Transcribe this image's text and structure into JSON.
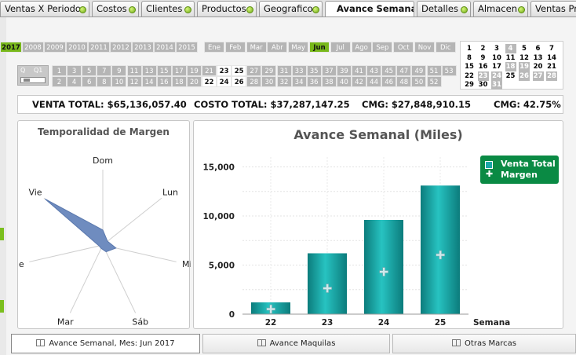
{
  "tabs": [
    {
      "label": "Ventas X Periodo",
      "dot": true
    },
    {
      "label": "Costos",
      "dot": true
    },
    {
      "label": "Clientes",
      "dot": true
    },
    {
      "label": "Productos",
      "dot": true
    },
    {
      "label": "Geografico",
      "dot": true
    },
    {
      "label": "Avance Semanal",
      "dot": false,
      "active": true
    },
    {
      "label": "Detalles",
      "dot": true
    },
    {
      "label": "Almacen",
      "dot": true
    },
    {
      "label": "Ventas Pr",
      "dot": false
    }
  ],
  "years": {
    "items": [
      "2017",
      "2008",
      "2009",
      "2010",
      "2011",
      "2012",
      "2013",
      "2014",
      "2015"
    ],
    "selected": "2017"
  },
  "months": {
    "items": [
      "Ene",
      "Feb",
      "Mar",
      "Abr",
      "May",
      "Jun",
      "Jul",
      "Ago",
      "Sep",
      "Oct",
      "Nov",
      "Dic"
    ],
    "selected": "Jun",
    "white": [
      "Ene"
    ]
  },
  "week_search": {
    "label1": "Q",
    "label2": "Q1"
  },
  "weeks": {
    "row1": [
      "1",
      "3",
      "5",
      "7",
      "9",
      "11",
      "13",
      "15",
      "17",
      "19",
      "21",
      "23",
      "25",
      "27",
      "29",
      "31",
      "33",
      "35",
      "37",
      "39",
      "41",
      "43",
      "45",
      "47",
      "49",
      "51",
      "53"
    ],
    "row2": [
      "2",
      "4",
      "6",
      "8",
      "10",
      "12",
      "14",
      "16",
      "18",
      "20",
      "22",
      "24",
      "26",
      "28",
      "30",
      "32",
      "34",
      "36",
      "38",
      "40",
      "42",
      "44",
      "46",
      "48",
      "50",
      "52"
    ],
    "selected": [
      "22",
      "23",
      "24",
      "25",
      "26"
    ]
  },
  "calendar": {
    "rows": [
      [
        "1",
        "2",
        "3",
        "4",
        "5",
        "6",
        "7"
      ],
      [
        "8",
        "9",
        "10",
        "11",
        "12",
        "13",
        "14"
      ],
      [
        "15",
        "16",
        "17",
        "18",
        "19",
        "20",
        "21"
      ],
      [
        "22",
        "23",
        "24",
        "25",
        "26",
        "27",
        "28"
      ],
      [
        "29",
        "30",
        "31",
        "",
        "",
        "",
        ""
      ]
    ],
    "visible_rows": [
      [
        "",
        "1",
        "2",
        "3",
        "4",
        "5",
        "6",
        "7"
      ],
      [
        "",
        "8",
        "9",
        "10",
        "11",
        "12",
        "13",
        "14"
      ],
      [
        "",
        "15",
        "16",
        "17",
        "18",
        "19",
        "20",
        "21"
      ],
      [
        "",
        "22",
        "23",
        "24",
        "25",
        "26",
        "27",
        "28"
      ],
      [
        "",
        "29",
        "30",
        "31",
        "",
        "",
        "",
        ""
      ]
    ],
    "gray": [
      "4",
      "18",
      "19",
      "23",
      "24",
      "26",
      "27",
      "28",
      "31"
    ]
  },
  "totals": {
    "venta": "VENTA TOTAL: $65,136,057.40",
    "costo": "COSTO TOTAL: $37,287,147.25",
    "cmg": "CMG: $27,848,910.15",
    "cmg_pct": "CMG: 42.75%"
  },
  "radar": {
    "title": "Temporalidad de Margen",
    "axes": [
      "Dom",
      "Lun",
      "Mi",
      "Sáb",
      "Mar",
      "ue",
      "Vie"
    ],
    "values": [
      0.2,
      0.08,
      0.18,
      0.1,
      0.05,
      0.05,
      0.98
    ]
  },
  "chart_data": {
    "type": "bar",
    "title": "Avance Semanal (Miles)",
    "xlabel": "Semana",
    "ylabel": "",
    "categories": [
      "22",
      "23",
      "24",
      "25"
    ],
    "series": [
      {
        "name": "Venta Total",
        "type": "bar",
        "values": [
          1200,
          6200,
          9600,
          13100
        ]
      },
      {
        "name": "Margen",
        "type": "point",
        "values": [
          500,
          2600,
          4300,
          6000
        ]
      }
    ],
    "ylim": [
      0,
      16000
    ],
    "yticks": [
      "0",
      "5,000",
      "10,000",
      "15,000"
    ],
    "colors": {
      "bar": "#1aa7a7",
      "bar_dark": "#0c7c7c",
      "legend_bg": "#0a8a44"
    }
  },
  "bottom_tabs": [
    {
      "label": "Avance Semanal, Mes: Jun 2017",
      "active": true
    },
    {
      "label": "Avance Maquilas",
      "active": false
    },
    {
      "label": "Otras Marcas",
      "active": false
    }
  ]
}
